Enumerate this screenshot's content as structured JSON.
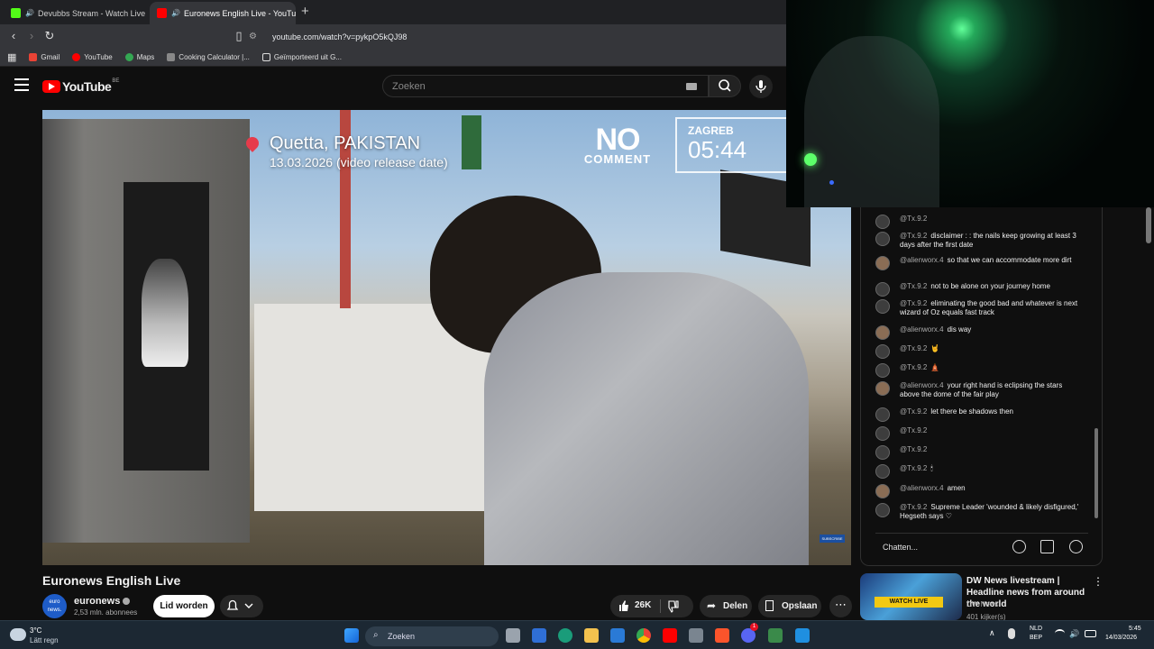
{
  "browser": {
    "tabs": [
      {
        "label": "Devubbs Stream - Watch Live on",
        "favicon_color": "#53fc18",
        "active": false
      },
      {
        "label": "Euronews English Live - YouTu",
        "favicon_color": "#ff0000",
        "active": true
      }
    ],
    "url": "youtube.com/watch?v=pykpO5kQJ98",
    "bookmarks": [
      {
        "label": "Gmail",
        "icon_color": "#ea4335"
      },
      {
        "label": "YouTube",
        "icon_color": "#ff0000"
      },
      {
        "label": "Maps",
        "icon_color": "#34a853"
      },
      {
        "label": "Cooking Calculator |...",
        "icon_color": "#888888"
      },
      {
        "label": "Geïmporteerd uit G...",
        "icon_color": "#ffffff"
      }
    ]
  },
  "youtube": {
    "logo_text": "YouTube",
    "country_code": "BE",
    "search_placeholder": "Zoeken"
  },
  "video": {
    "location_city": "Quetta, PAKISTAN",
    "location_date": "13.03.2026 (video release date)",
    "brand_top": "NO",
    "brand_bottom": "COMMENT",
    "clock_city": "ZAGREB",
    "clock_time": "05:44",
    "corner_badge": "SUBSCRIBE"
  },
  "details": {
    "title": "Euronews English Live",
    "channel": "euronews",
    "channel_avatar_text": "euro news.",
    "subscribers": "2,53 mln. abonnees",
    "join_label": "Lid worden",
    "likes": "26K",
    "share_label": "Delen",
    "save_label": "Opslaan"
  },
  "chat": {
    "messages": [
      {
        "author": "@Tx.9.2",
        "text": ""
      },
      {
        "author": "@Tx.9.2",
        "text": "disclaimer : : the nails keep growing at least 3 days after the first date"
      },
      {
        "author": "@alienworx.4",
        "text": "so that we can accommodate more dirt"
      },
      {
        "author": "@Tx.9.2",
        "text": "not to be alone on your journey home"
      },
      {
        "author": "@Tx.9.2",
        "text": "eliminating the good bad and whatever is next wizard of Oz equals fast track"
      },
      {
        "author": "@alienworx.4",
        "text": "dis way"
      },
      {
        "author": "@Tx.9.2",
        "text": "🤘"
      },
      {
        "author": "@Tx.9.2",
        "text": "🛕"
      },
      {
        "author": "@alienworx.4",
        "text": "your right hand is eclipsing the stars above the dome of the fair play"
      },
      {
        "author": "@Tx.9.2",
        "text": "let there be shadows then"
      },
      {
        "author": "@Tx.9.2",
        "text": ""
      },
      {
        "author": "@Tx.9.2",
        "text": ""
      },
      {
        "author": "@Tx.9.2",
        "text": "🕯"
      },
      {
        "author": "@alienworx.4",
        "text": "amen"
      },
      {
        "author": "@Tx.9.2",
        "text": "Supreme Leader 'wounded & likely disfigured,' Hegseth says ♡"
      }
    ],
    "input_placeholder": "Chatten..."
  },
  "related": {
    "badge": "WATCH LIVE",
    "title": "DW News livestream | Headline news from around the world",
    "channel": "DW News",
    "viewers": "401 kijker(s)"
  },
  "taskbar": {
    "temperature": "3°C",
    "weather": "Lätt regn",
    "search_placeholder": "Zoeken",
    "lang_top": "NLD",
    "lang_bottom": "BEP",
    "time": "5:45",
    "date": "14/03/2026",
    "notification_count": "1"
  }
}
